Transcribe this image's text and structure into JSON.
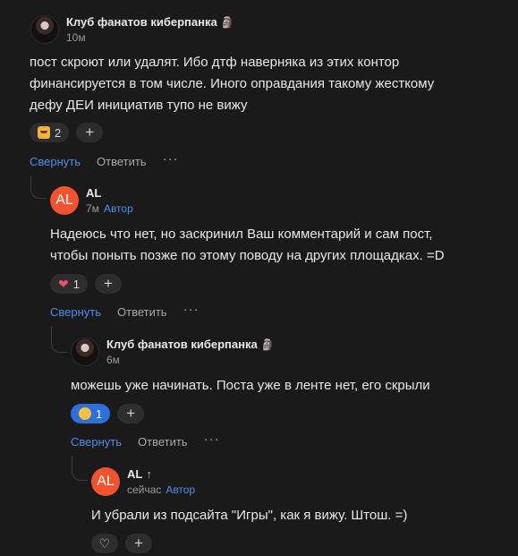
{
  "comments": [
    {
      "author": "Клуб фанатов киберпанка",
      "badge_icon": "moai-icon",
      "time": "10м",
      "text_lines": [
        "пост скроют или удалят. Ибо дтф наверняка из этих контор",
        "финансируется в том числе. Иного оправдания такому жесткому",
        "дефу ДЕИ инициатив тупо не вижу"
      ],
      "reaction": {
        "emoji": "cat-emoji",
        "count": "2"
      },
      "actions": {
        "collapse": "Свернуть",
        "reply": "Ответить",
        "more": "···"
      }
    },
    {
      "author": "AL",
      "avatar_text": "AL",
      "time": "7м",
      "author_tag": "Автор",
      "text_lines": [
        "Надеюсь что нет, но заскринил Ваш комментарий и сам пост,",
        "чтобы поныть позже по этому поводу на других площадках. =D"
      ],
      "reaction": {
        "emoji": "heart-emoji",
        "count": "1"
      },
      "actions": {
        "collapse": "Свернуть",
        "reply": "Ответить",
        "more": "···"
      }
    },
    {
      "author": "Клуб фанатов киберпанка",
      "badge_icon": "moai-icon",
      "time": "6м",
      "text_lines": [
        "можешь уже начинать. Поста уже в ленте нет, его скрыли"
      ],
      "reaction": {
        "emoji": "sad-face-emoji",
        "count": "1"
      },
      "actions": {
        "collapse": "Свернуть",
        "reply": "Ответить",
        "more": "···"
      }
    },
    {
      "author": "AL",
      "avatar_text": "AL",
      "time": "сейчас",
      "author_tag": "Автор",
      "text_lines": [
        "И убрали из подсайта \"Игры\", как я вижу. Штош. =)"
      ]
    }
  ],
  "colors": {
    "accent": "#4d8ee8",
    "avatar_al": "#f2522e",
    "active_reaction": "#2d6fdc",
    "background": "#1a1a1a"
  }
}
